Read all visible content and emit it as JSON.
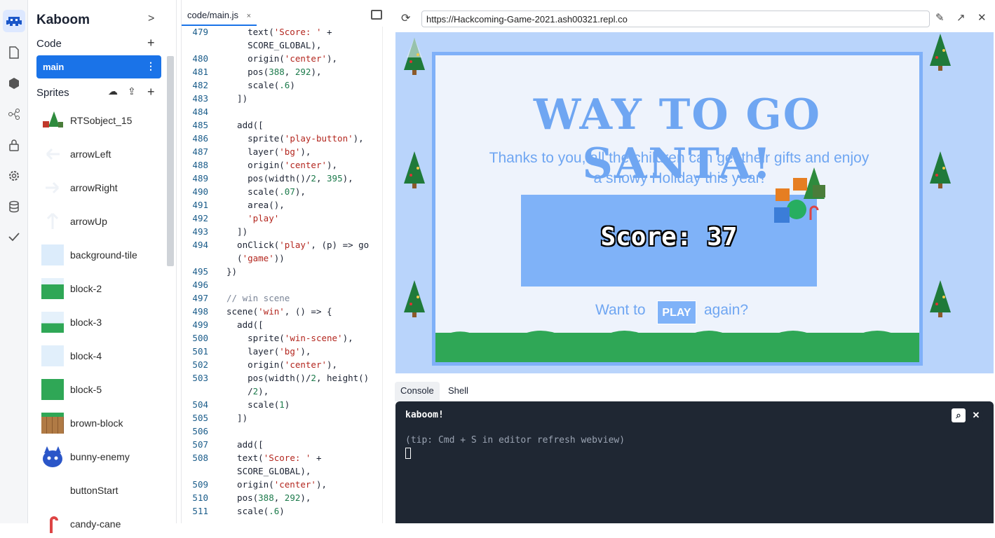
{
  "sidebar": {
    "title": "Kaboom",
    "code_section": "Code",
    "active_file": "main",
    "sprites_section": "Sprites",
    "sprites": [
      {
        "label": "RTSobject_15"
      },
      {
        "label": "arrowLeft"
      },
      {
        "label": "arrowRight"
      },
      {
        "label": "arrowUp"
      },
      {
        "label": "background-tile"
      },
      {
        "label": "block-2"
      },
      {
        "label": "block-3"
      },
      {
        "label": "block-4"
      },
      {
        "label": "block-5"
      },
      {
        "label": "brown-block"
      },
      {
        "label": "bunny-enemy"
      },
      {
        "label": "buttonStart"
      },
      {
        "label": "candy-cane"
      }
    ]
  },
  "editor": {
    "tab_label": "code/main.js",
    "tab_close": "×",
    "line_numbers": [
      "479",
      "",
      "480",
      "481",
      "482",
      "483",
      "484",
      "485",
      "486",
      "487",
      "488",
      "489",
      "490",
      "491",
      "492",
      "493",
      "494",
      "",
      "495",
      "496",
      "497",
      "498",
      "499",
      "500",
      "501",
      "502",
      "503",
      "",
      "504",
      "505",
      "506",
      "507",
      "508",
      "",
      "509",
      "510",
      "511"
    ]
  },
  "preview": {
    "url": "https://Hackcoming-Game-2021.ash00321.repl.co",
    "win_title": "WAY TO GO SANTA!",
    "win_subtitle_line1": "Thanks to you, all the children can get their gifts and enjoy",
    "win_subtitle_line2": "a snowy Holiday this year!",
    "score_text": "Score: 37",
    "want_to": "Want to",
    "play_label": "PLAY",
    "again": "again?"
  },
  "console": {
    "tab_console": "Console",
    "tab_shell": "Shell",
    "title": "kaboom!",
    "tip": "(tip: Cmd + S in editor refresh webview)"
  },
  "colors": {
    "accent": "#1a73e8",
    "game_blue": "#6fa6f2",
    "console_bg": "#1f2733"
  }
}
